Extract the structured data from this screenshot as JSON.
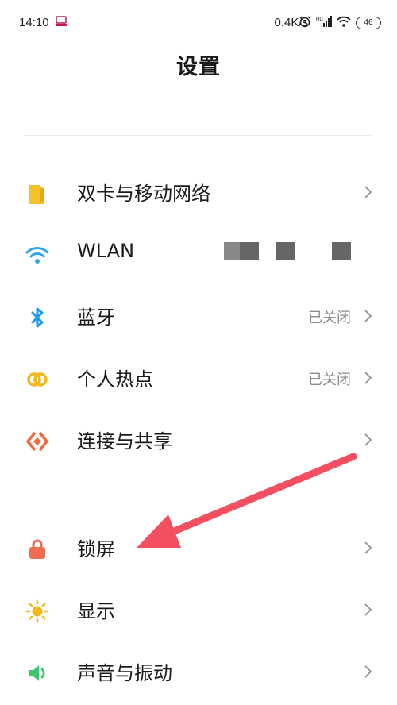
{
  "status_bar": {
    "time": "14:10",
    "network_speed": "0.4K/s",
    "battery_level": "46"
  },
  "header": {
    "title": "设置"
  },
  "settings_items": [
    {
      "label": "双卡与移动网络",
      "value": "",
      "icon": "sim-card-icon",
      "color": "#f5c12b"
    },
    {
      "label": "WLAN",
      "value": "",
      "icon": "wifi-icon",
      "color": "#2fa6ea"
    },
    {
      "label": "蓝牙",
      "value": "已关闭",
      "icon": "bluetooth-icon",
      "color": "#1b9cf0"
    },
    {
      "label": "个人热点",
      "value": "已关闭",
      "icon": "hotspot-icon",
      "color": "#f1b81c"
    },
    {
      "label": "连接与共享",
      "value": "",
      "icon": "connection-share-icon",
      "color": "#f06a3a"
    },
    {
      "label": "锁屏",
      "value": "",
      "icon": "lock-icon",
      "color": "#f26a52"
    },
    {
      "label": "显示",
      "value": "",
      "icon": "sun-icon",
      "color": "#f6b81d"
    },
    {
      "label": "声音与振动",
      "value": "",
      "icon": "speaker-icon",
      "color": "#3ac86a"
    }
  ],
  "annotation": {
    "arrow_color": "#f25060"
  }
}
